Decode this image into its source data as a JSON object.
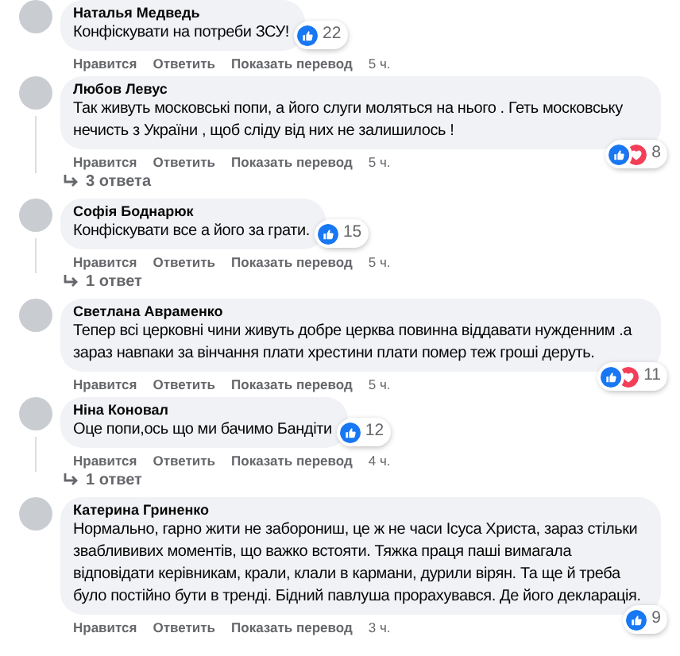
{
  "comments": [
    {
      "author": "Наталья Медведь",
      "text": "Конфіскувати на потреби ЗСУ!",
      "reactions": [
        {
          "kind": "like"
        }
      ],
      "reaction_count": "22",
      "actions": [
        "Нравится",
        "Ответить",
        "Показать перевод"
      ],
      "time": "5 ч."
    },
    {
      "author": "Любов Левус",
      "text": "Так живуть московські попи, а його слуги моляться на нього . Геть московську нечисть з України , щоб сліду від них не залишилось !",
      "reactions": [
        {
          "kind": "like"
        },
        {
          "kind": "love"
        }
      ],
      "reaction_count": "8",
      "actions": [
        "Нравится",
        "Ответить",
        "Показать перевод"
      ],
      "time": "5 ч.",
      "replies": "3 ответа"
    },
    {
      "author": "Софія Боднарюк",
      "text": "Конфіскувати все а його за грати.",
      "reactions": [
        {
          "kind": "like"
        }
      ],
      "reaction_count": "15",
      "actions": [
        "Нравится",
        "Ответить",
        "Показать перевод"
      ],
      "time": "5 ч.",
      "replies": "1 ответ"
    },
    {
      "author": "Светлана Авраменко",
      "text": "Тепер всі церковні чини живуть добре церква повинна віддавати нужденним .а зараз навпаки за вінчання плати хрестини плати помер теж гроші деруть.",
      "reactions": [
        {
          "kind": "like"
        },
        {
          "kind": "love"
        }
      ],
      "reaction_count": "11",
      "actions": [
        "Нравится",
        "Ответить",
        "Показать перевод"
      ],
      "time": "5 ч."
    },
    {
      "author": "Ніна Коновал",
      "text": "Оце попи,ось що ми бачимо Бандіти",
      "reactions": [
        {
          "kind": "like"
        }
      ],
      "reaction_count": "12",
      "actions": [
        "Нравится",
        "Ответить",
        "Показать перевод"
      ],
      "time": "4 ч.",
      "replies": "1 ответ"
    },
    {
      "author": "Катерина Гриненко",
      "text": "Нормально, гарно жити не заборониш, це ж не часи Ісуса Христа, зараз стільки зваблививих моментів, що важко встояти. Тяжка праця паші вимагала відповідати керівникам, крали, клали в кармани, дурили вірян. Та ще й треба було постійно бути в тренді. Бідний павлуша прорахувався. Де його декларація.",
      "reactions": [
        {
          "kind": "like"
        }
      ],
      "reaction_count": "9",
      "actions": [
        "Нравится",
        "Ответить",
        "Показать перевод"
      ],
      "time": "3 ч."
    }
  ]
}
